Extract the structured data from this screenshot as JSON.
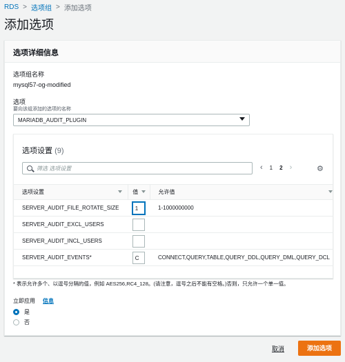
{
  "breadcrumb": {
    "items": [
      "RDS",
      "选项组"
    ],
    "current": "添加选项"
  },
  "page_title": "添加选项",
  "card": {
    "header": "选项详细信息",
    "group_name_label": "选项组名称",
    "group_name_value": "mysql57-og-modified",
    "option_label": "选项",
    "option_sublabel": "要向该组添加的选项的名称",
    "option_value": "MARIADB_AUDIT_PLUGIN"
  },
  "settings": {
    "title": "选项设置",
    "count": "(9)",
    "search_placeholder": "筛选 选项设置",
    "pages": [
      "1",
      "2"
    ],
    "columns": [
      "选项设置",
      "值",
      "允许值"
    ],
    "rows": [
      {
        "name": "SERVER_AUDIT_FILE_ROTATE_SIZE",
        "value": "1",
        "allowed": "1-1000000000"
      },
      {
        "name": "SERVER_AUDIT_EXCL_USERS",
        "value": "",
        "allowed": ""
      },
      {
        "name": "SERVER_AUDIT_INCL_USERS",
        "value": "",
        "allowed": ""
      },
      {
        "name": "SERVER_AUDIT_EVENTS*",
        "value": "C",
        "allowed": "CONNECT,QUERY,TABLE,QUERY_DDL,QUERY_DML,QUERY_DCL"
      }
    ]
  },
  "note": "* 表示允许多个、以逗号分隔的值，例如 AES256,RC4_128。(请注意，逗号之后不能有空格。)否则，只允许一个单一值。",
  "apply": {
    "label": "立即应用",
    "info": "信息",
    "options": [
      "是",
      "否"
    ],
    "selected": "是"
  },
  "footer": {
    "cancel": "取消",
    "submit": "添加选项"
  },
  "colors": {
    "accent": "#0073bb",
    "primary_button": "#ec7211"
  }
}
